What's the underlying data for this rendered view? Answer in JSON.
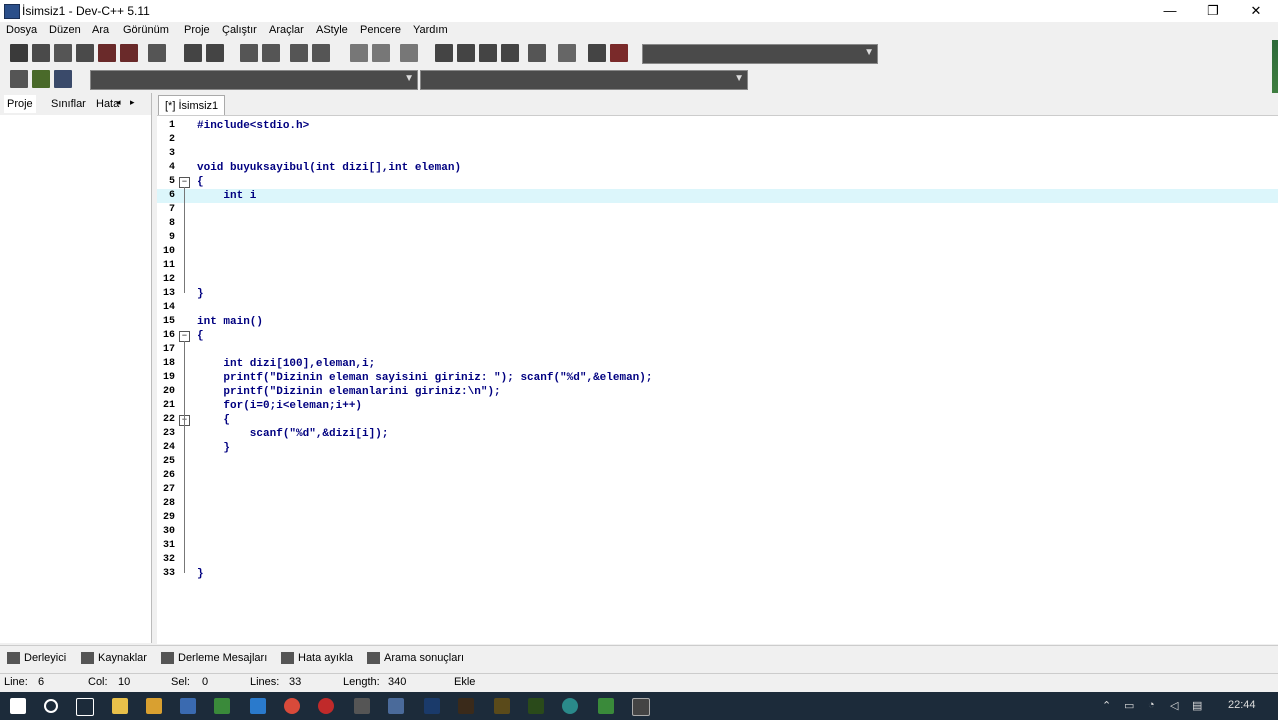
{
  "window": {
    "title": "İsimsiz1 - Dev-C++ 5.11",
    "min": "—",
    "max": "❐",
    "close": "✕"
  },
  "menu": [
    "Dosya",
    "Düzen",
    "Ara",
    "Görünüm",
    "Proje",
    "Çalıştır",
    "Araçlar",
    "AStyle",
    "Pencere",
    "Yardım"
  ],
  "left_tabs": [
    "Proje",
    "Sınıflar",
    "Hata"
  ],
  "editor_tab": "[*] İsimsiz1",
  "code_lines": [
    {
      "n": "1",
      "text": "#include<stdio.h>"
    },
    {
      "n": "2",
      "text": ""
    },
    {
      "n": "3",
      "text": ""
    },
    {
      "n": "4",
      "text": "void buyuksayibul(int dizi[],int eleman)"
    },
    {
      "n": "5",
      "text": "{"
    },
    {
      "n": "6",
      "text": "    int i"
    },
    {
      "n": "7",
      "text": ""
    },
    {
      "n": "8",
      "text": ""
    },
    {
      "n": "9",
      "text": ""
    },
    {
      "n": "10",
      "text": ""
    },
    {
      "n": "11",
      "text": ""
    },
    {
      "n": "12",
      "text": ""
    },
    {
      "n": "13",
      "text": "}"
    },
    {
      "n": "14",
      "text": ""
    },
    {
      "n": "15",
      "text": "int main()"
    },
    {
      "n": "16",
      "text": "{"
    },
    {
      "n": "17",
      "text": ""
    },
    {
      "n": "18",
      "text": "    int dizi[100],eleman,i;"
    },
    {
      "n": "19",
      "text": "    printf(\"Dizinin eleman sayisini giriniz: \"); scanf(\"%d\",&eleman);"
    },
    {
      "n": "20",
      "text": "    printf(\"Dizinin elemanlarini giriniz:\\n\");"
    },
    {
      "n": "21",
      "text": "    for(i=0;i<eleman;i++)"
    },
    {
      "n": "22",
      "text": "    {"
    },
    {
      "n": "23",
      "text": "        scanf(\"%d\",&dizi[i]);"
    },
    {
      "n": "24",
      "text": "    }"
    },
    {
      "n": "25",
      "text": ""
    },
    {
      "n": "26",
      "text": ""
    },
    {
      "n": "27",
      "text": ""
    },
    {
      "n": "28",
      "text": ""
    },
    {
      "n": "29",
      "text": ""
    },
    {
      "n": "30",
      "text": ""
    },
    {
      "n": "31",
      "text": ""
    },
    {
      "n": "32",
      "text": ""
    },
    {
      "n": "33",
      "text": "}"
    }
  ],
  "bottom_tabs": [
    "Derleyici",
    "Kaynaklar",
    "Derleme Mesajları",
    "Hata ayıkla",
    "Arama sonuçları"
  ],
  "status": {
    "line_label": "Line:",
    "line": "6",
    "col_label": "Col:",
    "col": "10",
    "sel_label": "Sel:",
    "sel": "0",
    "lines_label": "Lines:",
    "lines": "33",
    "length_label": "Length:",
    "length": "340",
    "mode": "Ekle"
  },
  "clock": "22:44",
  "colors": {
    "code": "#000080",
    "highlight": "#dcf6fb",
    "taskbar": "#1c2b3a"
  }
}
